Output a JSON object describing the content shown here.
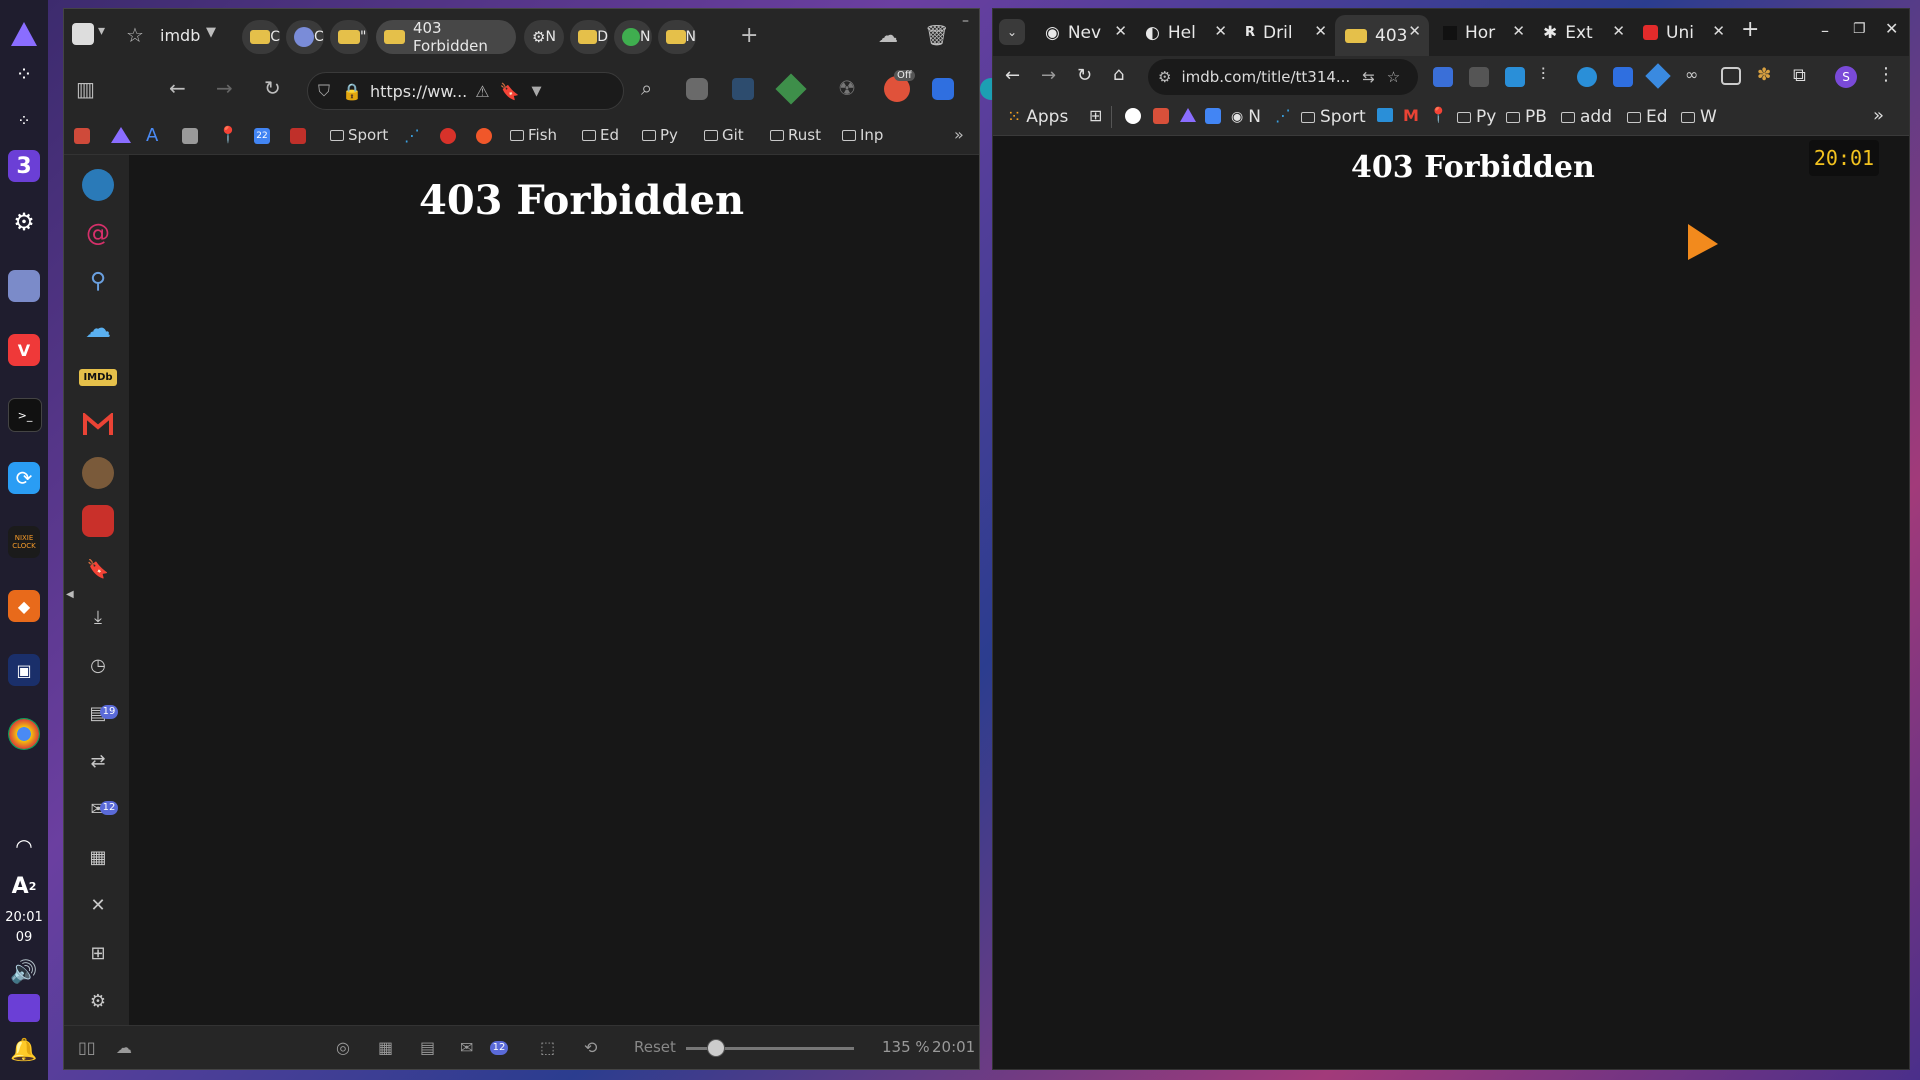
{
  "taskbar": {
    "workspace_number": "3",
    "clock_time": "20:01",
    "clock_day": "09",
    "keyboard_layout": "A",
    "keyboard_super": "2",
    "nixie_label": "NIXIE CLOCK",
    "icons": [
      "app-launcher-icon",
      "workspace-icon",
      "workspace-alt-icon",
      "workspace-number-icon",
      "settings-icon",
      "files-icon",
      "vivaldi-icon",
      "terminal-icon",
      "sync-icon",
      "nixie-clock-icon",
      "fox-icon",
      "monitor-icon",
      "chrome-icon",
      "wifi-icon",
      "keyboard-icon",
      "volume-icon",
      "desktop-icon",
      "notification-icon"
    ]
  },
  "vivaldi": {
    "workspace_label": "imdb",
    "active_tab_title": "403 Forbidden",
    "tab_fragments": [
      "C",
      "C",
      "\"",
      "N",
      "D",
      "N",
      "N"
    ],
    "url": "https://ww...",
    "ext_off_badge": "Off",
    "bookmarks": [
      {
        "label": "Sport",
        "type": "folder"
      },
      {
        "label": "Fish",
        "type": "folder"
      },
      {
        "label": "Ed",
        "type": "folder"
      },
      {
        "label": "Py",
        "type": "folder"
      },
      {
        "label": "Git",
        "type": "folder"
      },
      {
        "label": "Rust",
        "type": "folder"
      },
      {
        "label": "Inp",
        "type": "folder"
      }
    ],
    "calendar_day": "22",
    "page_heading": "403 Forbidden",
    "panel_badge_one": "19",
    "panel_badge_two": "12",
    "imdb_label": "IMDb",
    "status": {
      "reset_label": "Reset",
      "zoom_level": 135,
      "zoom_text": "135 %",
      "time": "20:01",
      "mail_badge": "12"
    }
  },
  "chrome": {
    "tabs": [
      {
        "label": "Nev",
        "active": false
      },
      {
        "label": "Hel",
        "active": false
      },
      {
        "label": "Dril",
        "active": false
      },
      {
        "label": "403",
        "active": true
      },
      {
        "label": "Hor",
        "active": false
      },
      {
        "label": "Ext",
        "active": false
      },
      {
        "label": "Uni",
        "active": false
      }
    ],
    "url": "imdb.com/title/tt314...",
    "profile_initial": "S",
    "bookmarks": [
      {
        "label": "Apps",
        "type": "apps"
      },
      {
        "label": "N",
        "type": "site"
      },
      {
        "label": "Sport",
        "type": "folder"
      },
      {
        "label": "Py",
        "type": "folder"
      },
      {
        "label": "PB",
        "type": "folder"
      },
      {
        "label": "add",
        "type": "folder"
      },
      {
        "label": "Ed",
        "type": "folder"
      },
      {
        "label": "W",
        "type": "folder"
      }
    ],
    "page_heading": "403 Forbidden",
    "clock_widget": "20:01"
  },
  "colors": {
    "clock_yellow": "#f2c21f",
    "cursor_orange": "#f28a1d",
    "badge_blue": "#5a6ad8",
    "imdb_yellow": "#e5c04a"
  }
}
